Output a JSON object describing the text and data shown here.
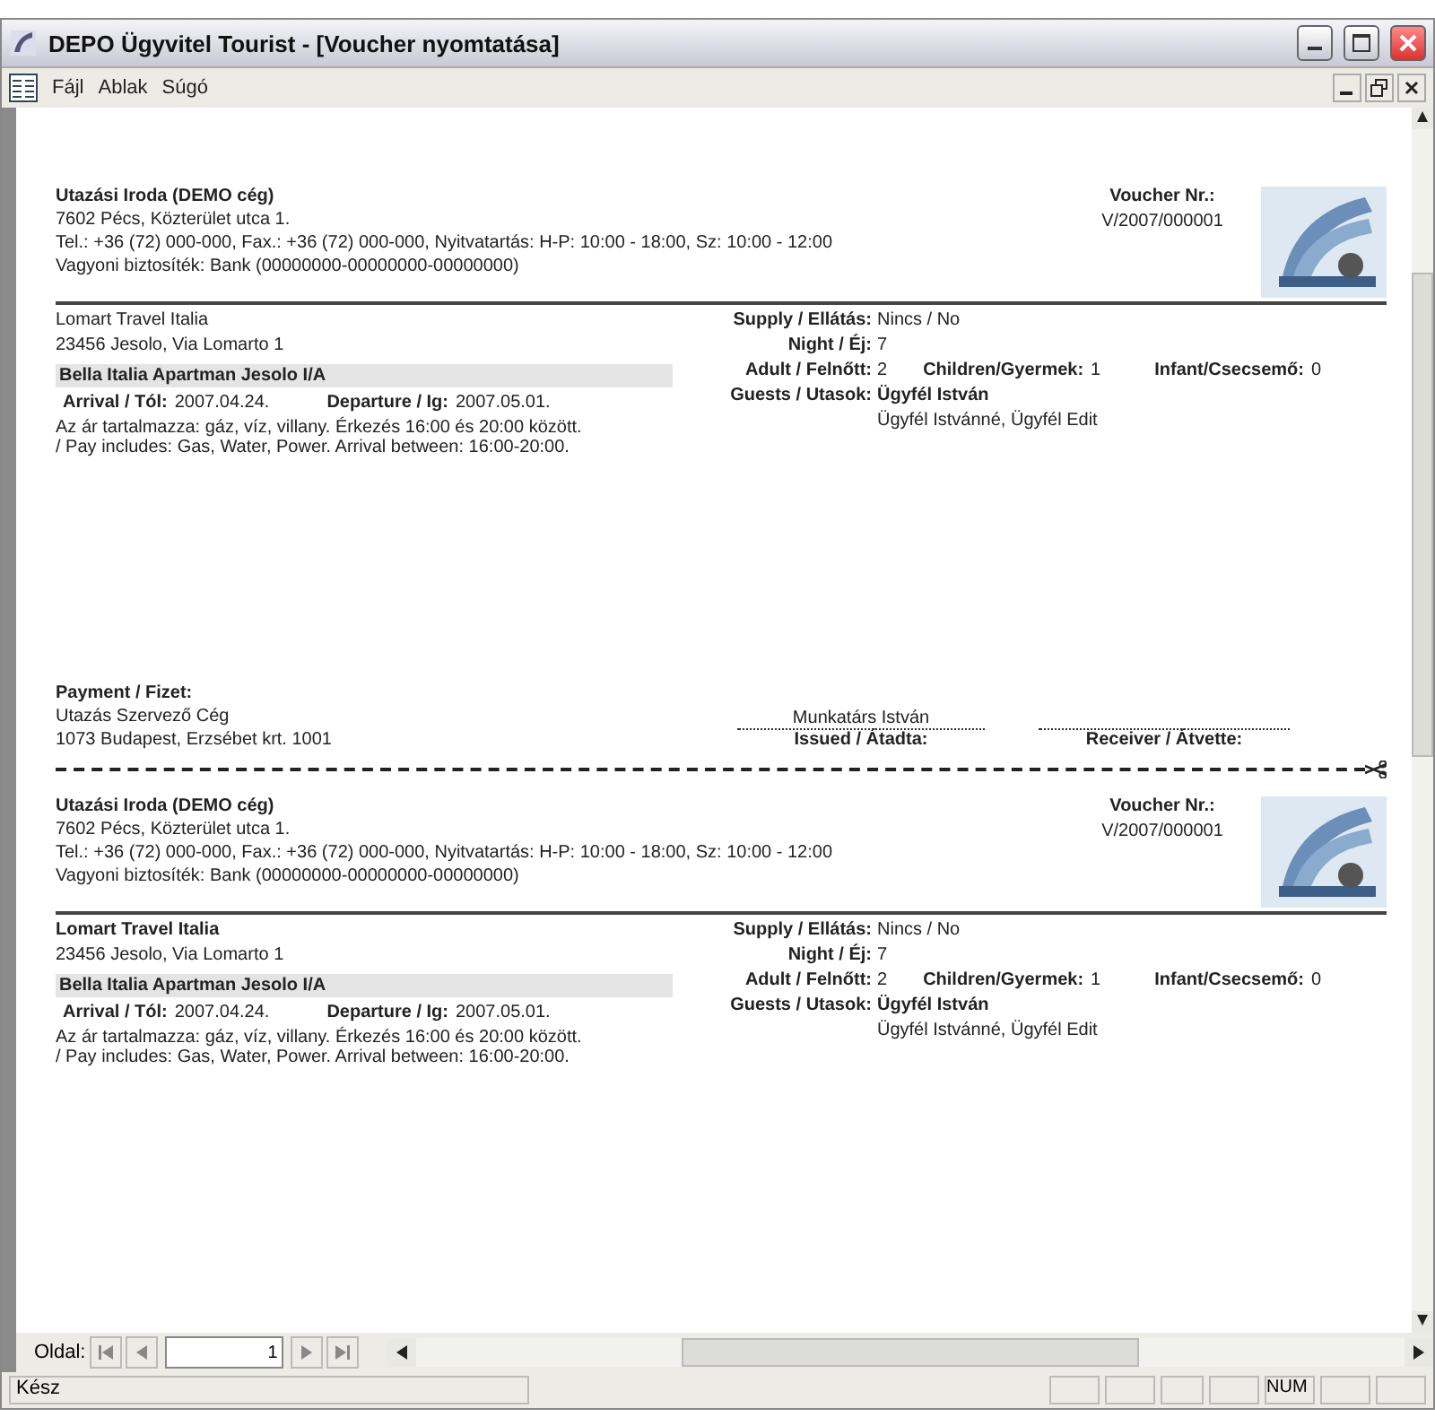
{
  "window": {
    "title": "DEPO Ügyvitel Tourist - [Voucher nyomtatása]"
  },
  "menu": [
    {
      "label": "Fájl"
    },
    {
      "label": "Ablak"
    },
    {
      "label": "Súgó"
    }
  ],
  "vouchers": [
    {
      "agency": {
        "name": "Utazási Iroda (DEMO cég)",
        "address": "7602 Pécs, Közterület utca 1.",
        "contact": "Tel.: +36 (72) 000-000, Fax.: +36 (72) 000-000, Nyitvatartás: H-P: 10:00 - 18:00, Sz: 10:00 - 12:00",
        "guarantee": "Vagyoni biztosíték: Bank (00000000-00000000-00000000)"
      },
      "voucher_label": "Voucher Nr.:",
      "voucher_no": "V/2007/000001",
      "partner": {
        "name": "Lomart Travel Italia",
        "address": "23456 Jesolo, Via Lomarto 1",
        "bold": false
      },
      "accommodation": "Bella Italia Apartman Jesolo I/A",
      "arrival_label": "Arrival / Tól:",
      "arrival": "2007.04.24.",
      "departure_label": "Departure / Ig:",
      "departure": "2007.05.01.",
      "note": [
        "Az ár tartalmazza: gáz, víz, villany. Érkezés 16:00 és 20:00 között.",
        "/ Pay includes: Gas, Water, Power. Arrival between: 16:00-20:00."
      ],
      "supply_label": "Supply / Ellátás:",
      "supply": "Nincs / No",
      "night_label": "Night / Éj:",
      "night": "7",
      "adult_label": "Adult / Felnőtt:",
      "adult": "2",
      "children_label": "Children/Gyermek:",
      "children": "1",
      "infant_label": "Infant/Csecsemő:",
      "infant": "0",
      "guests_label": "Guests / Utasok:",
      "guest_main": "Ügyfél István",
      "guests_more": "Ügyfél Istvánné, Ügyfél Edit",
      "payment": {
        "label": "Payment / Fizet:",
        "name": "Utazás Szervező Cég",
        "address": "1073 Budapest, Erzsébet krt. 1001",
        "issuer": "Munkatárs István",
        "issued_label": "Issued / Átadta:",
        "receiver_label": "Receiver / Átvette:"
      }
    },
    {
      "agency": {
        "name": "Utazási Iroda (DEMO cég)",
        "address": "7602 Pécs, Közterület utca 1.",
        "contact": "Tel.: +36 (72) 000-000, Fax.: +36 (72) 000-000, Nyitvatartás: H-P: 10:00 - 18:00, Sz: 10:00 - 12:00",
        "guarantee": "Vagyoni biztosíték: Bank (00000000-00000000-00000000)"
      },
      "voucher_label": "Voucher Nr.:",
      "voucher_no": "V/2007/000001",
      "partner": {
        "name": "Lomart Travel Italia",
        "address": "23456 Jesolo, Via Lomarto 1",
        "bold": true
      },
      "accommodation": "Bella Italia Apartman Jesolo I/A",
      "arrival_label": "Arrival / Tól:",
      "arrival": "2007.04.24.",
      "departure_label": "Departure / Ig:",
      "departure": "2007.05.01.",
      "note": [
        "Az ár tartalmazza: gáz, víz, villany. Érkezés 16:00 és 20:00 között.",
        "/ Pay includes: Gas, Water, Power. Arrival between: 16:00-20:00."
      ],
      "supply_label": "Supply / Ellátás:",
      "supply": "Nincs / No",
      "night_label": "Night / Éj:",
      "night": "7",
      "adult_label": "Adult / Felnőtt:",
      "adult": "2",
      "children_label": "Children/Gyermek:",
      "children": "1",
      "infant_label": "Infant/Csecsemő:",
      "infant": "0",
      "guests_label": "Guests / Utasok:",
      "guest_main": "Ügyfél István",
      "guests_more": "Ügyfél Istvánné, Ügyfél Edit"
    }
  ],
  "pager": {
    "label": "Oldal:",
    "page": "1"
  },
  "status": {
    "text": "Kész",
    "indicator": "NUM"
  }
}
